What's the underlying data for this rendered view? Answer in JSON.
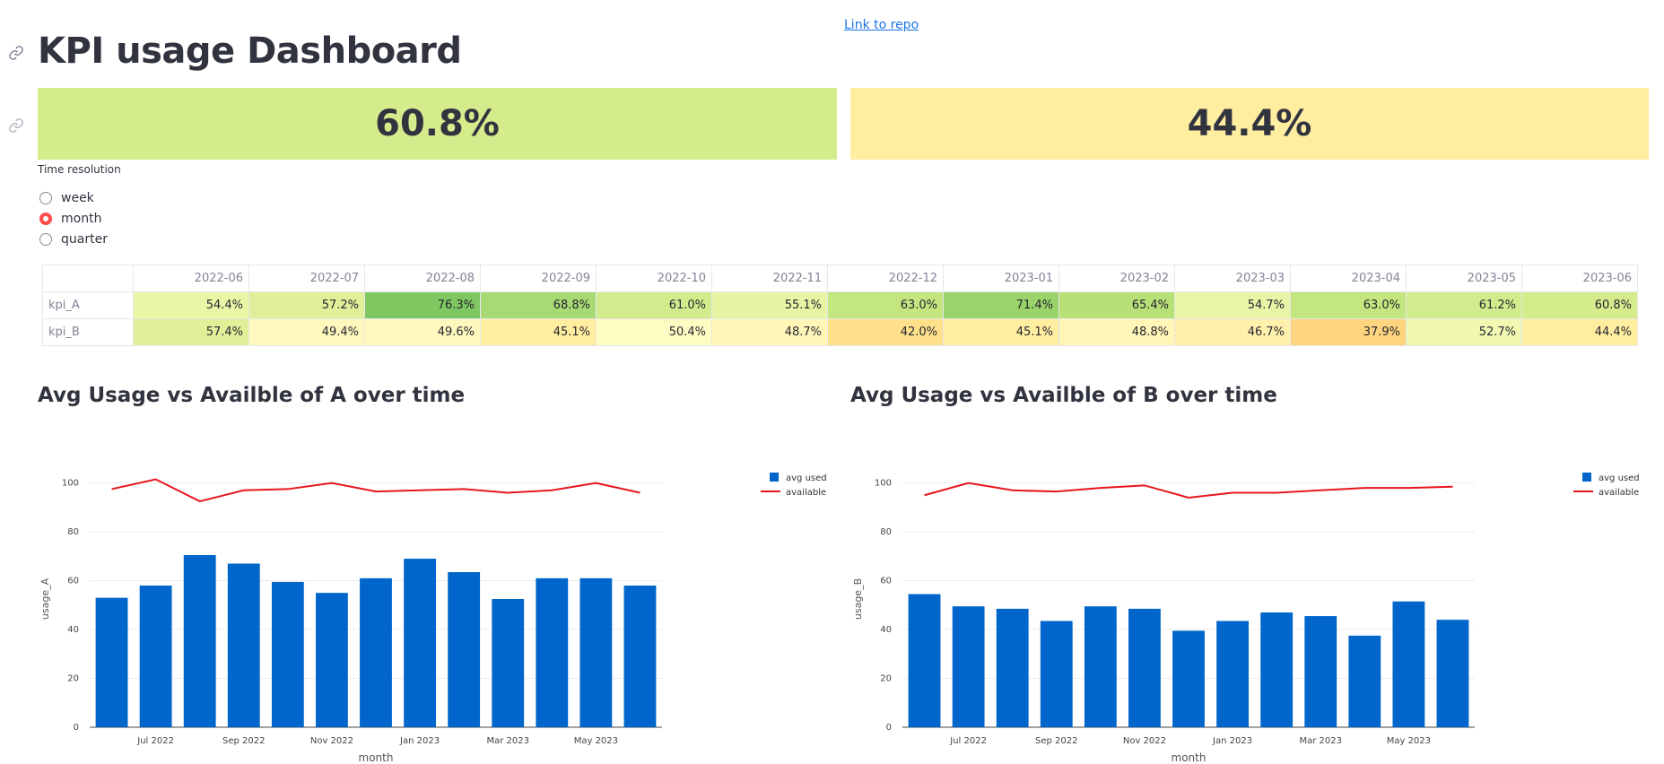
{
  "header": {
    "repo_link": "Link to repo",
    "title": "KPI usage Dashboard"
  },
  "kpi_cards": [
    {
      "value": "60.8%",
      "color": "#d5ec8c"
    },
    {
      "value": "44.4%",
      "color": "#ffeda0"
    }
  ],
  "time_resolution": {
    "label": "Time resolution",
    "options": [
      "week",
      "month",
      "quarter"
    ],
    "selected": "month"
  },
  "table": {
    "columns": [
      "2022-06",
      "2022-07",
      "2022-08",
      "2022-09",
      "2022-10",
      "2022-11",
      "2022-12",
      "2023-01",
      "2023-02",
      "2023-03",
      "2023-04",
      "2023-05",
      "2023-06"
    ],
    "rows": [
      {
        "name": "kpi_A",
        "values": [
          "54.4%",
          "57.2%",
          "76.3%",
          "68.8%",
          "61.0%",
          "55.1%",
          "63.0%",
          "71.4%",
          "65.4%",
          "54.7%",
          "63.0%",
          "61.2%",
          "60.8%"
        ],
        "colors": [
          "#e9f6a6",
          "#dff098",
          "#7fc861",
          "#a8da74",
          "#d2ec8d",
          "#e6f4a4",
          "#c3e67f",
          "#99d369",
          "#b7e077",
          "#e8f5a6",
          "#c3e67f",
          "#d2ec8d",
          "#d5ec8c"
        ]
      },
      {
        "name": "kpi_B",
        "values": [
          "57.4%",
          "49.4%",
          "49.6%",
          "45.1%",
          "50.4%",
          "48.7%",
          "42.0%",
          "45.1%",
          "48.8%",
          "46.7%",
          "37.9%",
          "52.7%",
          "44.4%"
        ],
        "colors": [
          "#dff098",
          "#fff8bd",
          "#fff8bd",
          "#ffeda0",
          "#fffcc3",
          "#fff6b7",
          "#fedf8a",
          "#ffeda0",
          "#fff6b7",
          "#fff0ab",
          "#fed47f",
          "#f0f8b2",
          "#ffeda0"
        ]
      }
    ]
  },
  "section_titles": {
    "a": "Avg Usage vs Availble of A over time",
    "b": "Avg Usage vs Availble of B over time"
  },
  "chart_data": [
    {
      "type": "bar",
      "categories": [
        "2022-06",
        "2022-07",
        "2022-08",
        "2022-09",
        "2022-10",
        "2022-11",
        "2022-12",
        "2023-01",
        "2023-02",
        "2023-03",
        "2023-04",
        "2023-05",
        "2023-06"
      ],
      "series": [
        {
          "name": "avg used",
          "kind": "bar",
          "color": "#0066cc",
          "values": [
            53,
            58,
            70.5,
            67,
            59.5,
            55,
            61,
            69,
            63.5,
            52.5,
            61,
            61,
            58
          ]
        },
        {
          "name": "available",
          "kind": "line",
          "color": "#e8141c",
          "values": [
            97.5,
            101.5,
            92.5,
            97,
            97.5,
            100,
            96.5,
            97,
            97.5,
            96,
            97,
            100,
            96
          ]
        }
      ],
      "xlabel": "month",
      "ylabel": "usage_A",
      "ylim": [
        0,
        105
      ],
      "yticks": [
        0,
        20,
        40,
        60,
        80,
        100
      ],
      "xtick_labels": {
        "1": "Jul 2022",
        "3": "Sep 2022",
        "5": "Nov 2022",
        "7": "Jan 2023",
        "9": "Mar 2023",
        "11": "May 2023"
      },
      "legend": "top-right",
      "grid": true
    },
    {
      "type": "bar",
      "categories": [
        "2022-06",
        "2022-07",
        "2022-08",
        "2022-09",
        "2022-10",
        "2022-11",
        "2022-12",
        "2023-01",
        "2023-02",
        "2023-03",
        "2023-04",
        "2023-05",
        "2023-06"
      ],
      "series": [
        {
          "name": "avg used",
          "kind": "bar",
          "color": "#0066cc",
          "values": [
            54.5,
            49.5,
            48.5,
            43.5,
            49.5,
            48.5,
            39.5,
            43.5,
            47,
            45.5,
            37.5,
            51.5,
            44
          ]
        },
        {
          "name": "available",
          "kind": "line",
          "color": "#e8141c",
          "values": [
            95,
            100,
            97,
            96.5,
            98,
            99,
            94,
            96,
            96,
            97,
            98,
            98,
            98.5
          ]
        }
      ],
      "xlabel": "month",
      "ylabel": "usage_B",
      "ylim": [
        0,
        105
      ],
      "yticks": [
        0,
        20,
        40,
        60,
        80,
        100
      ],
      "xtick_labels": {
        "1": "Jul 2022",
        "3": "Sep 2022",
        "5": "Nov 2022",
        "7": "Jan 2023",
        "9": "Mar 2023",
        "11": "May 2023"
      },
      "legend": "top-right",
      "grid": true
    }
  ]
}
